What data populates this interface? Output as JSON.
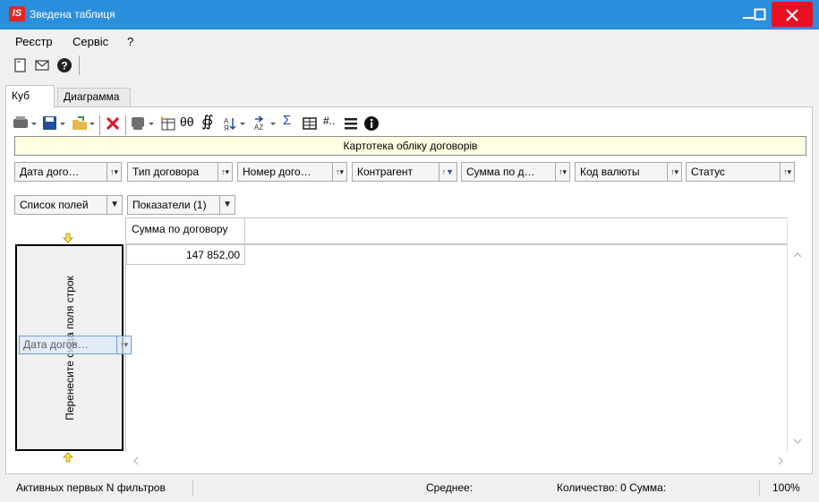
{
  "window": {
    "title": "Зведена таблиця",
    "logo": "IS"
  },
  "menu": {
    "items": [
      "Реєстр",
      "Сервіс",
      "?"
    ]
  },
  "tabs": [
    {
      "label": "Куб",
      "active": true
    },
    {
      "label": "Диаграмма",
      "active": false
    }
  ],
  "toolbar2": {
    "icons": [
      "print-icon",
      "save-icon",
      "open-folder-icon",
      "delete-icon",
      "color-icon",
      "table-settings-icon",
      "infinity-icon",
      "link-icon",
      "sort-asc-icon",
      "sort-desc-icon",
      "sum-icon",
      "grid-icon",
      "number-format-icon",
      "list-icon",
      "info-icon"
    ]
  },
  "cube": {
    "title": "Картотека обліку договорів"
  },
  "filter_fields": [
    {
      "label": "Дата дого…",
      "sort": "↑▾"
    },
    {
      "label": "Тип договора",
      "sort": "↑▾"
    },
    {
      "label": "Номер дого…",
      "sort": "↑▾"
    },
    {
      "label": "Контрагент",
      "sort": "↑▼"
    },
    {
      "label": "Сумма по д…",
      "sort": "↑▾"
    },
    {
      "label": "Код валюты",
      "sort": "↑▾"
    },
    {
      "label": "Статус",
      "sort": "↑▾"
    }
  ],
  "row_fields": {
    "list_label": "Список полей",
    "indicators_label": "Показатели (1)"
  },
  "grid": {
    "column_header": "Сумма по договору",
    "value": "147 852,00"
  },
  "drop_zone": {
    "text": "Перенесите сюда поля строк"
  },
  "drag_ghost": {
    "label": "Дата догов…",
    "sort": "↑▾"
  },
  "status": {
    "active_filters": "Активных первых N фильтров",
    "average": "Среднее:",
    "count_sum": "Количество: 0  Сумма:",
    "zoom": "100%"
  },
  "colors": {
    "titlebar": "#2a8fdc",
    "close_button": "#e81123",
    "cube_title_bg": "#ffffe1",
    "delete_red": "#e81123"
  }
}
